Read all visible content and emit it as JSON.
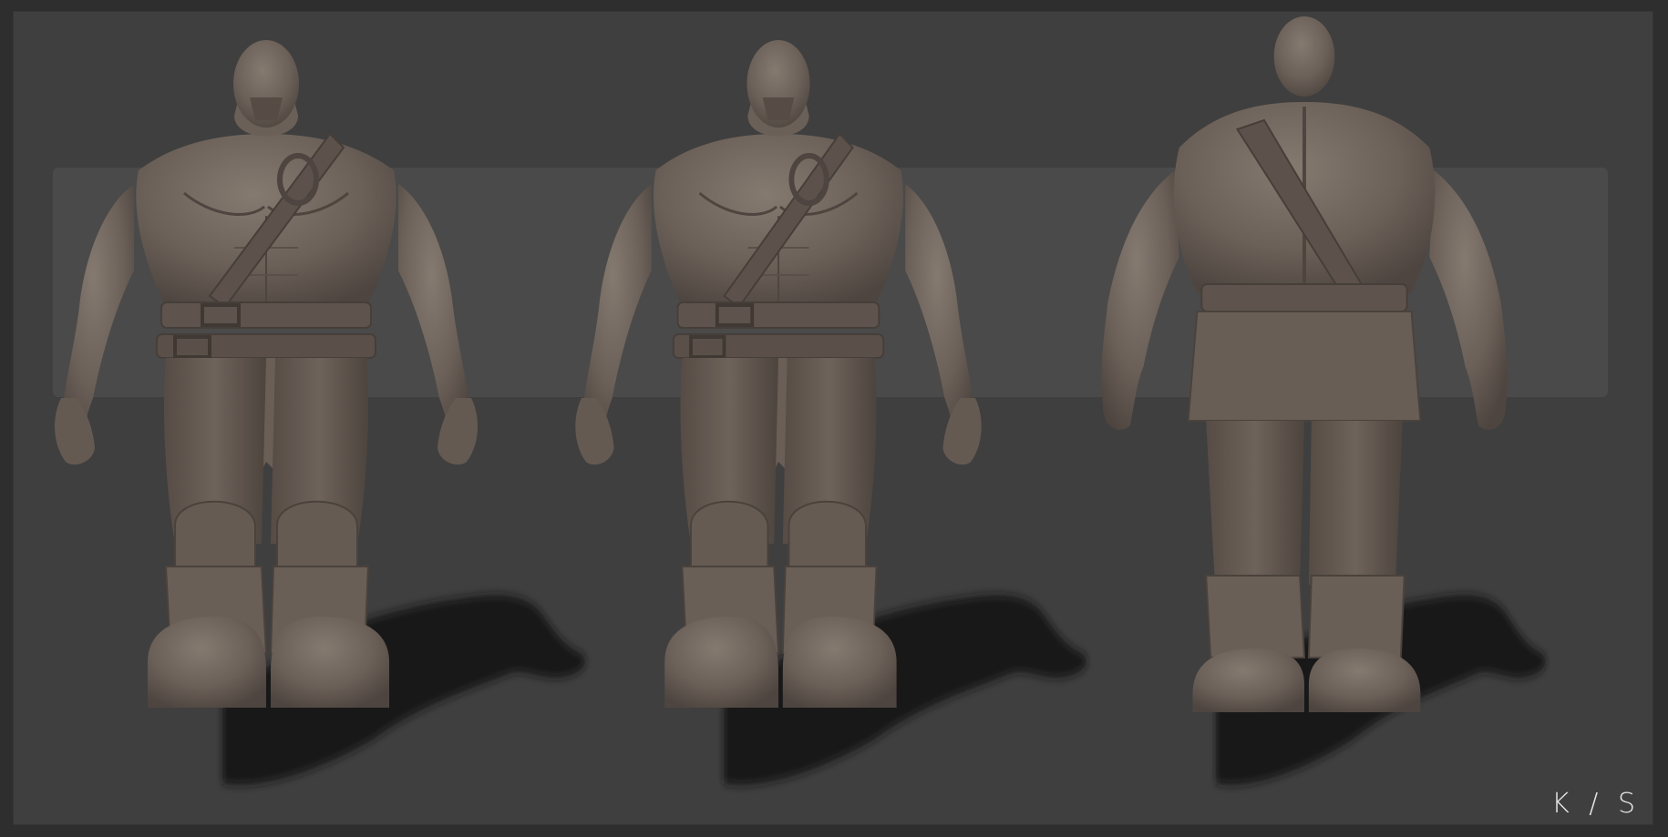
{
  "artwork": {
    "signature": "K / S",
    "figure_count": 3,
    "views": [
      "front",
      "three-quarter",
      "back"
    ],
    "colors": {
      "outer_border": "#2e2e2e",
      "background": "#3f3f3f",
      "backdrop_band": "#4a4a4a",
      "clay": "#6b6058",
      "clay_light": "#857a70",
      "clay_dark": "#4e4540",
      "shadow": "#141414",
      "signature": "#e6e6e6"
    }
  }
}
